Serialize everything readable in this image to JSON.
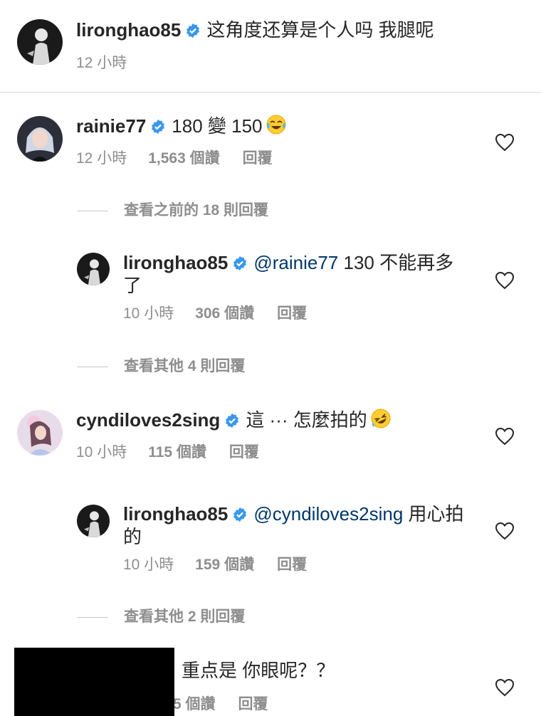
{
  "caption": {
    "username": "lironghao85",
    "text": "这角度还算是个人吗 我腿呢",
    "time": "12 小時"
  },
  "comments": [
    {
      "username": "rainie77",
      "text": "180 變 150",
      "emoji": "laughing-tears-emoji",
      "time": "12 小時",
      "likes": "1,563 個讚",
      "reply": "回覆"
    },
    {
      "view_more": "查看之前的 18 則回覆"
    },
    {
      "username": "lironghao85",
      "mention": "@rainie77",
      "text": " 130 不能再多了",
      "time": "10 小時",
      "likes": "306 個讚",
      "reply": "回覆"
    },
    {
      "view_more": "查看其他 4 則回覆"
    },
    {
      "username": "cyndiloves2sing",
      "text": "這 ··· 怎麼拍的",
      "emoji": "rolling-laughing-emoji",
      "time": "10 小時",
      "likes": "115 個讚",
      "reply": "回覆"
    },
    {
      "username": "lironghao85",
      "mention": "@cyndiloves2sing",
      "text": " 用心拍的",
      "time": "10 小時",
      "likes": "159 個讚",
      "reply": "回覆"
    },
    {
      "view_more": "查看其他 2 則回覆"
    },
    {
      "text": "重点是 你眼呢？？",
      "likes": "5 個讚",
      "reply": "回覆"
    }
  ],
  "colors": {
    "verified": "#3897f0",
    "mention": "#00376b",
    "meta": "#8e8e8e",
    "text": "#262626"
  }
}
